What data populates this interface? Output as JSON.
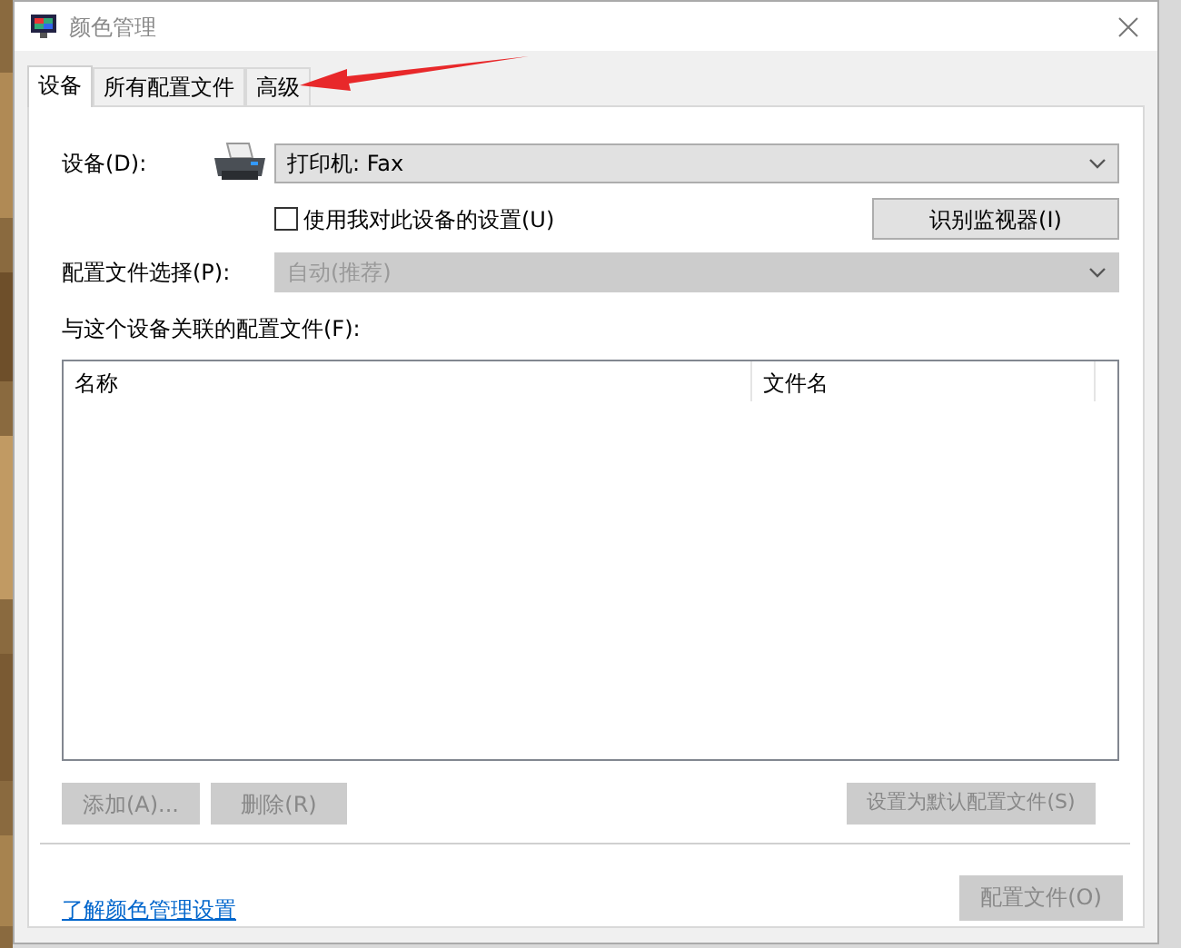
{
  "window": {
    "title": "颜色管理"
  },
  "tabs": [
    {
      "label": "设备",
      "selected": true
    },
    {
      "label": "所有配置文件",
      "selected": false
    },
    {
      "label": "高级",
      "selected": false
    }
  ],
  "device": {
    "label": "设备(D):",
    "value": "打印机: Fax"
  },
  "use_my_settings": {
    "label": "使用我对此设备的设置(U)",
    "checked": false
  },
  "identify_button": {
    "label": "识别监视器(I)",
    "disabled": false
  },
  "profile_selection": {
    "label": "配置文件选择(P):",
    "value": "自动(推荐)",
    "disabled": true
  },
  "associated": {
    "label": "与这个设备关联的配置文件(F):",
    "columns": [
      "名称",
      "文件名"
    ]
  },
  "list_buttons": [
    {
      "label": "添加(A)...",
      "disabled": true
    },
    {
      "label": "删除(R)",
      "disabled": true
    },
    {
      "label": "设置为默认配置文件(S)",
      "disabled": true
    }
  ],
  "footer": {
    "link": "了解颜色管理设置",
    "button": {
      "label": "配置文件(O)",
      "disabled": true
    }
  }
}
